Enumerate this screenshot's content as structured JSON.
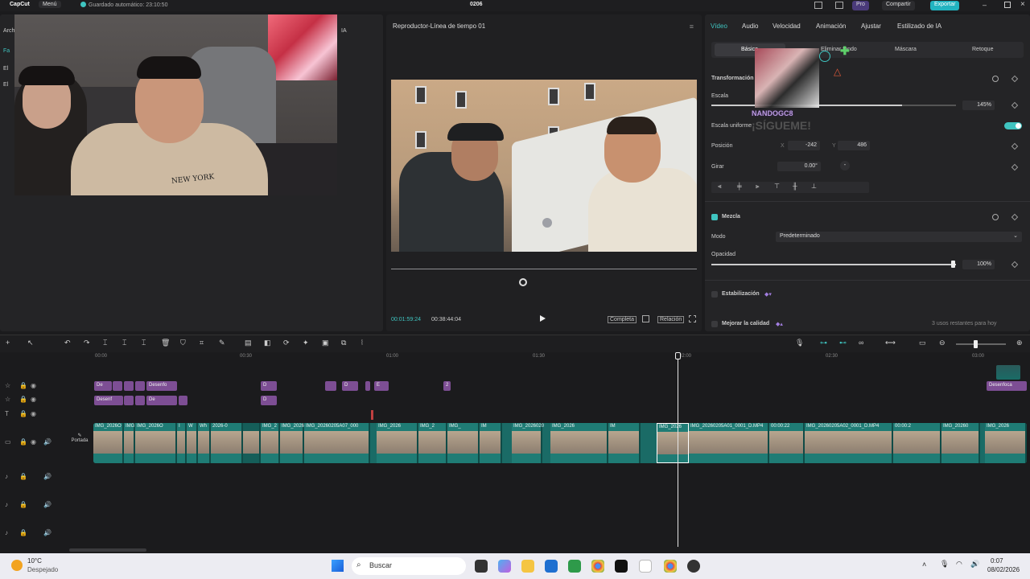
{
  "topbar": {
    "logo": "CapCut",
    "menu": "Menú",
    "autosave": "Guardado automático: 23:10:50",
    "project_title": "0206",
    "pro": "Pro",
    "share": "Compartir",
    "export": "Exportar"
  },
  "left_panel": {
    "tab_fragment": "Arch",
    "ai_fragment": "IA",
    "items": [
      "Fa",
      "El",
      "El"
    ]
  },
  "webcam_text": "NEW YORK",
  "player": {
    "title": "Reproductor-Línea de tiempo 01",
    "current_time": "00:01:59:24",
    "total_time": "00:38:44:04",
    "full_label": "Completa",
    "ratio_label": "Relación"
  },
  "right_panel": {
    "tabs": [
      "Vídeo",
      "Audio",
      "Velocidad",
      "Animación",
      "Ajustar",
      "Estilizado de IA"
    ],
    "subtabs": [
      "Básico",
      "Eliminar fondo",
      "Máscara",
      "Retoque"
    ],
    "transform_header": "Transformación",
    "scale_label": "Escala",
    "scale_value": "145%",
    "scale_fraction": 0.78,
    "uniform_label": "Escala uniforme",
    "position_label": "Posición",
    "pos_x_label": "X",
    "pos_x": "-242",
    "pos_y_label": "Y",
    "pos_y": "486",
    "rotate_label": "Girar",
    "rotate_value": "0.00°",
    "blend_header": "Mezcla",
    "mode_label": "Modo",
    "mode_value": "Predeterminado",
    "opacity_label": "Opacidad",
    "opacity_value": "100%",
    "opacity_fraction": 1.0,
    "stabilize_label": "Estabilización",
    "enhance_label": "Mejorar la calidad",
    "uses_left": "3 usos restantes para hoy",
    "overlay_text": "NANDOGC8",
    "overlay_text2": "¡SÍGUEME!"
  },
  "timeline": {
    "ruler": [
      "00:00",
      "00:30",
      "01:00",
      "01:30",
      "02:00",
      "02:30",
      "03:00"
    ],
    "cover_label": "Portada",
    "effects_row1": [
      "De",
      "",
      "",
      "",
      "Desenfo",
      "D",
      "",
      "D",
      "",
      "E",
      "2",
      "Desenfoca"
    ],
    "effects_row2": [
      "Desenf",
      "",
      "",
      "De",
      "",
      "D"
    ],
    "clip_labels": [
      "IMG_2026O",
      "IMG",
      "IMG_2026O",
      "I",
      "W",
      "Wh",
      "2026-0",
      "",
      "IMG_2",
      "IMG_2026O1",
      "IMG_20260205A07_000",
      "IMG_2026",
      "IMG_2",
      "IMG_",
      "IM",
      "IMG_2026020",
      "IMG_2026",
      "IMG_20260205A01_0001_D.MP4",
      "00:00:22",
      "IMG_20260205A02_0001_D.MP4",
      "00:00:2",
      "IMG_20260",
      "IMG_2026"
    ]
  },
  "taskbar": {
    "temp": "10°C",
    "weather": "Despejado",
    "search": "Buscar",
    "time": "0:07",
    "date": "08/02/2026"
  },
  "colors": {
    "accent": "#3fc4c0",
    "effect_clip": "#7d4e94",
    "video_clip": "#1f7c75",
    "export": "#21b3c0"
  }
}
